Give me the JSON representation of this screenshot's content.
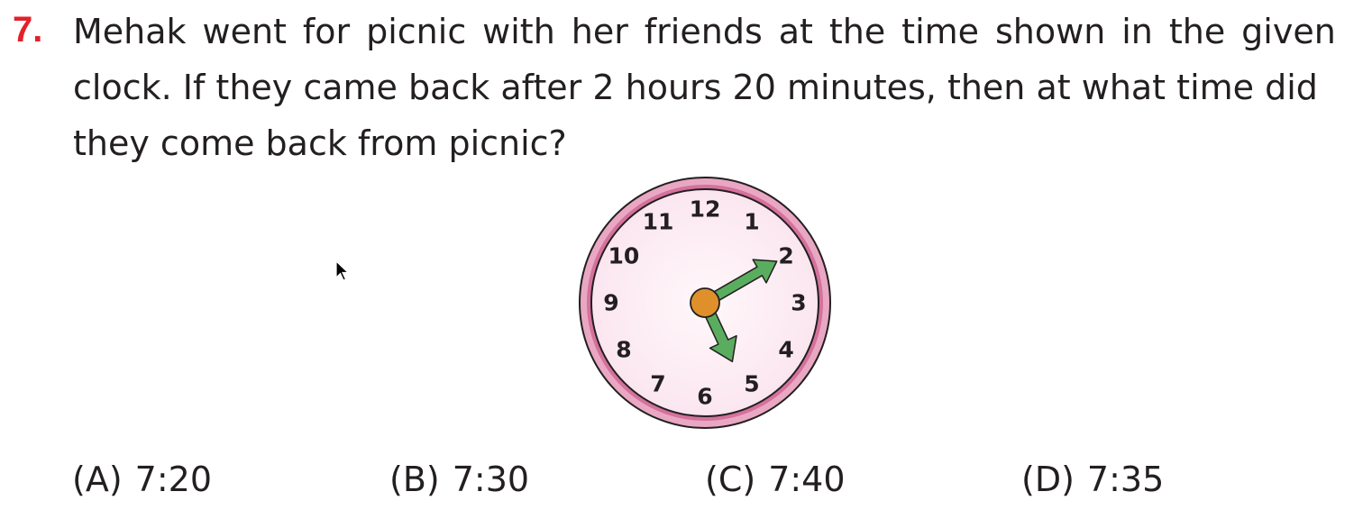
{
  "question": {
    "number": "7.",
    "lines": [
      [
        "Mehak",
        "went",
        "for",
        "picnic",
        "with",
        "her",
        "friends",
        "at",
        "the",
        "time",
        "shown",
        "in",
        "the",
        "given"
      ],
      "clock. If they came back after 2 hours 20 minutes, then at what time did",
      "they come back from picnic?"
    ]
  },
  "clock": {
    "numerals": [
      "12",
      "1",
      "2",
      "3",
      "4",
      "5",
      "6",
      "7",
      "8",
      "9",
      "10",
      "11"
    ],
    "time_shown": {
      "hour": 5,
      "minute": 10
    },
    "colors": {
      "rim": "#d4719c",
      "face": "#fdf0f5",
      "hands": "#5aad5e",
      "center": "#e0902a"
    }
  },
  "options": [
    {
      "label": "(A)",
      "value": "7:20"
    },
    {
      "label": "(B)",
      "value": "7:30"
    },
    {
      "label": "(C)",
      "value": "7:40"
    },
    {
      "label": "(D)",
      "value": "7:35"
    }
  ],
  "colors": {
    "question_number": "#e4202a",
    "text": "#231f20"
  }
}
